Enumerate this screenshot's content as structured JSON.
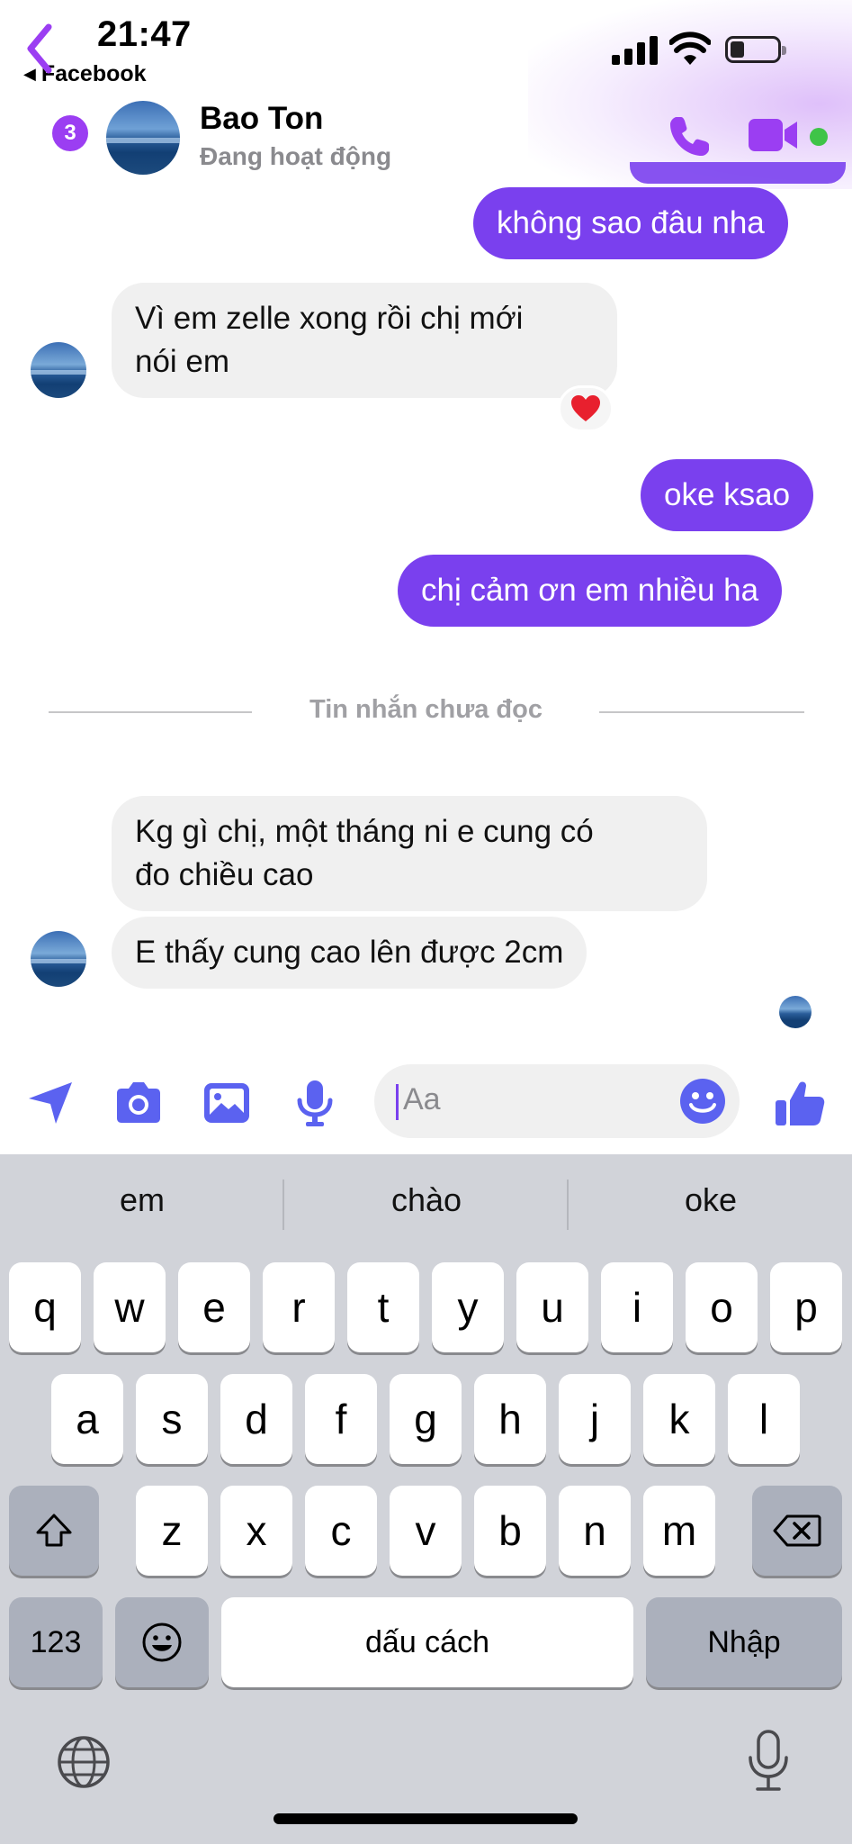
{
  "status_bar": {
    "time": "21:47",
    "back_app": "Facebook"
  },
  "header": {
    "unread_badge": "3",
    "contact_name": "Bao Ton",
    "presence": "Đang hoạt động"
  },
  "messages": [
    {
      "direction": "out",
      "text": "không sao đâu nha"
    },
    {
      "direction": "in",
      "line1": "Vì em zelle xong rồi chị mới",
      "line2": "nói em",
      "reaction": "❤️"
    },
    {
      "direction": "out",
      "text": "oke ksao"
    },
    {
      "direction": "out",
      "text": "chị cảm ơn em nhiều ha"
    },
    {
      "direction": "in",
      "line1": "Kg gì chị, một tháng ni e cung có",
      "line2": "đo chiều cao"
    },
    {
      "direction": "in",
      "text": "E thấy cung cao lên được 2cm"
    }
  ],
  "divider": {
    "label": "Tin nhắn chưa đọc"
  },
  "composer": {
    "placeholder": "Aa"
  },
  "keyboard": {
    "suggestions": [
      "em",
      "chào",
      "oke"
    ],
    "row1": [
      "q",
      "w",
      "e",
      "r",
      "t",
      "y",
      "u",
      "i",
      "o",
      "p"
    ],
    "row2": [
      "a",
      "s",
      "d",
      "f",
      "g",
      "h",
      "j",
      "k",
      "l"
    ],
    "row3": [
      "z",
      "x",
      "c",
      "v",
      "b",
      "n",
      "m"
    ],
    "numbers_label": "123",
    "space_label": "dấu cách",
    "return_label": "Nhập"
  },
  "colors": {
    "accent": "#7a40ee",
    "incoming_bubble": "#f0f0f0",
    "online": "#3fc448",
    "keyboard_bg": "#d1d3d9"
  }
}
